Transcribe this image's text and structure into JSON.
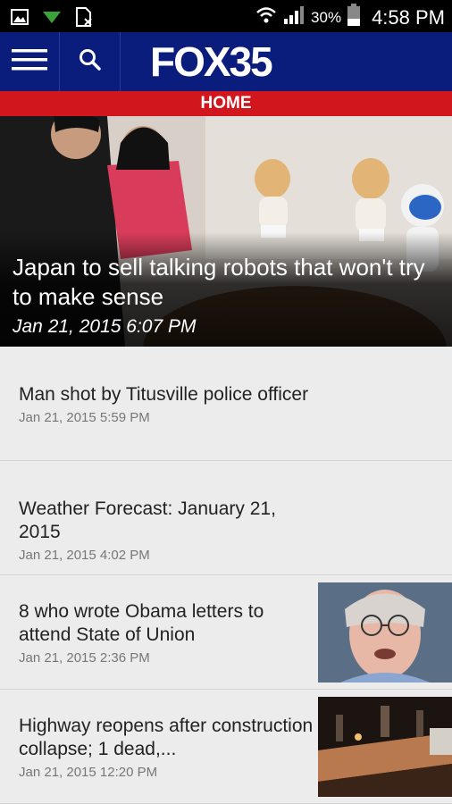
{
  "status_bar": {
    "battery_percent": "30%",
    "time": "4:58 PM"
  },
  "header": {
    "logo_text": "FOX35",
    "section": "HOME"
  },
  "hero": {
    "title": "Japan to sell talking robots that won't try to make sense",
    "date": "Jan 21, 2015 6:07 PM"
  },
  "stories": [
    {
      "title": "Man shot by Titusville police officer",
      "date": "Jan 21, 2015 5:59 PM"
    },
    {
      "title": "Weather Forecast: January 21, 2015",
      "date": "Jan 21, 2015 4:02 PM"
    },
    {
      "title": "8 who wrote Obama letters to attend State of Union",
      "date": "Jan 21, 2015 2:36 PM"
    },
    {
      "title": "Highway reopens after construction collapse; 1 dead,...",
      "date": "Jan 21, 2015 12:20 PM"
    }
  ],
  "colors": {
    "header_blue": "#0a1c7c",
    "banner_red": "#d2161d",
    "list_background": "#ececec"
  },
  "icons": [
    "image-icon",
    "download-icon",
    "sim-card-icon",
    "wifi-icon",
    "signal-icon",
    "battery-icon",
    "menu-icon",
    "search-icon"
  ]
}
